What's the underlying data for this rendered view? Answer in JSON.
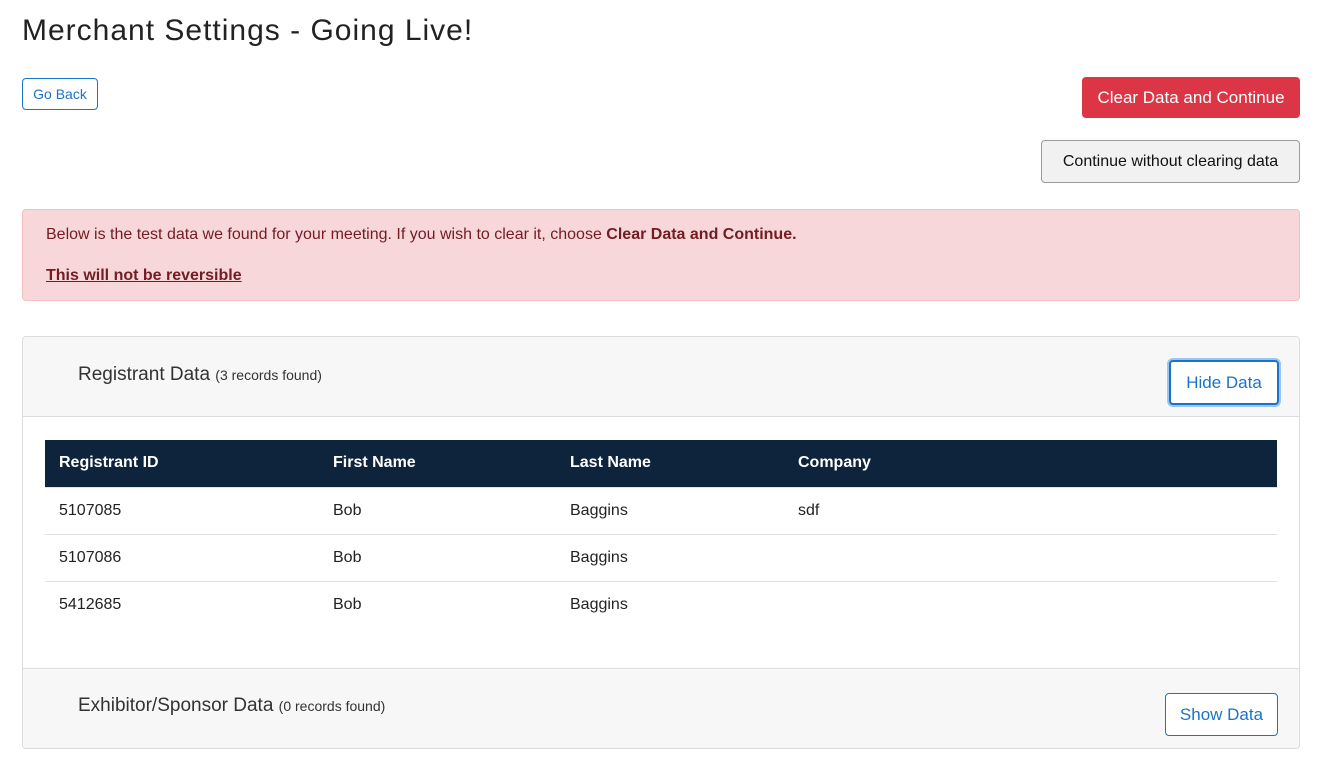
{
  "page": {
    "title": "Merchant Settings - Going Live!"
  },
  "actions": {
    "go_back": "Go Back",
    "clear_continue": "Clear Data and Continue",
    "continue_without": "Continue without clearing data"
  },
  "alert": {
    "message_prefix": "Below is the test data we found for your meeting. If you wish to clear it, choose ",
    "message_bold": "Clear Data and Continue.",
    "warning": "This will not be reversible"
  },
  "registrant_section": {
    "title": "Registrant Data",
    "count": "(3 records found)",
    "toggle_label": "Hide Data",
    "columns": [
      "Registrant ID",
      "First Name",
      "Last Name",
      "Company"
    ],
    "rows": [
      [
        "5107085",
        "Bob",
        "Baggins",
        "sdf"
      ],
      [
        "5107086",
        "Bob",
        "Baggins",
        ""
      ],
      [
        "5412685",
        "Bob",
        "Baggins",
        ""
      ]
    ]
  },
  "exhibitor_section": {
    "title": "Exhibitor/Sponsor Data",
    "count": "(0 records found)",
    "toggle_label": "Show Data"
  },
  "colors": {
    "danger": "#dc3545",
    "primary": "#1a73c9",
    "table_header": "#0e243c",
    "alert_bg": "#f8d7da",
    "alert_text": "#721c24"
  }
}
